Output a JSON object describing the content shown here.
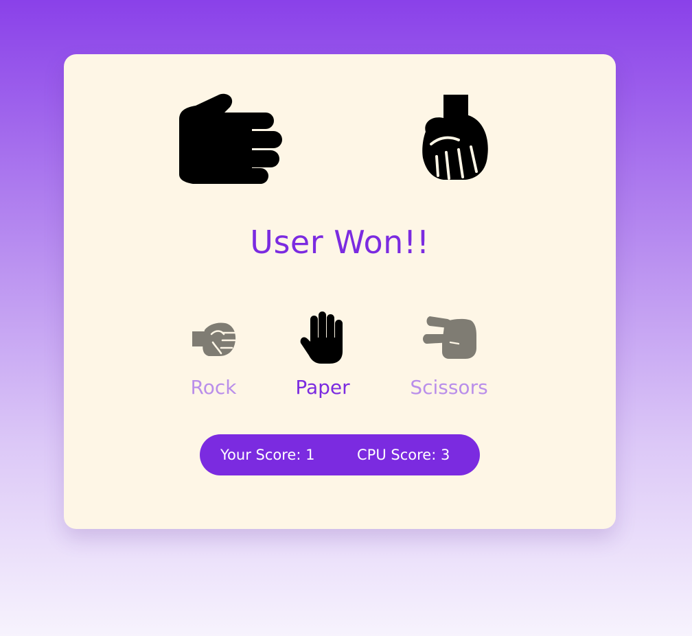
{
  "game": {
    "user_move_icon": "paper-hand-icon",
    "cpu_move_icon": "rock-fist-icon",
    "result_text": "User Won!!"
  },
  "choices": [
    {
      "label": "Rock",
      "icon": "rock-fist-icon",
      "selected": false
    },
    {
      "label": "Paper",
      "icon": "paper-hand-icon",
      "selected": true
    },
    {
      "label": "Scissors",
      "icon": "scissors-hand-icon",
      "selected": false
    }
  ],
  "score": {
    "user_label": "Your Score: 1",
    "cpu_label": "CPU Score: 3"
  },
  "colors": {
    "accent": "#7b2be0",
    "inactive_label": "#b98eea",
    "inactive_icon": "#7f7c73",
    "card_background": "#fef6e6",
    "gradient_top": "#8a41e9",
    "gradient_bottom": "#f7f3fd"
  }
}
